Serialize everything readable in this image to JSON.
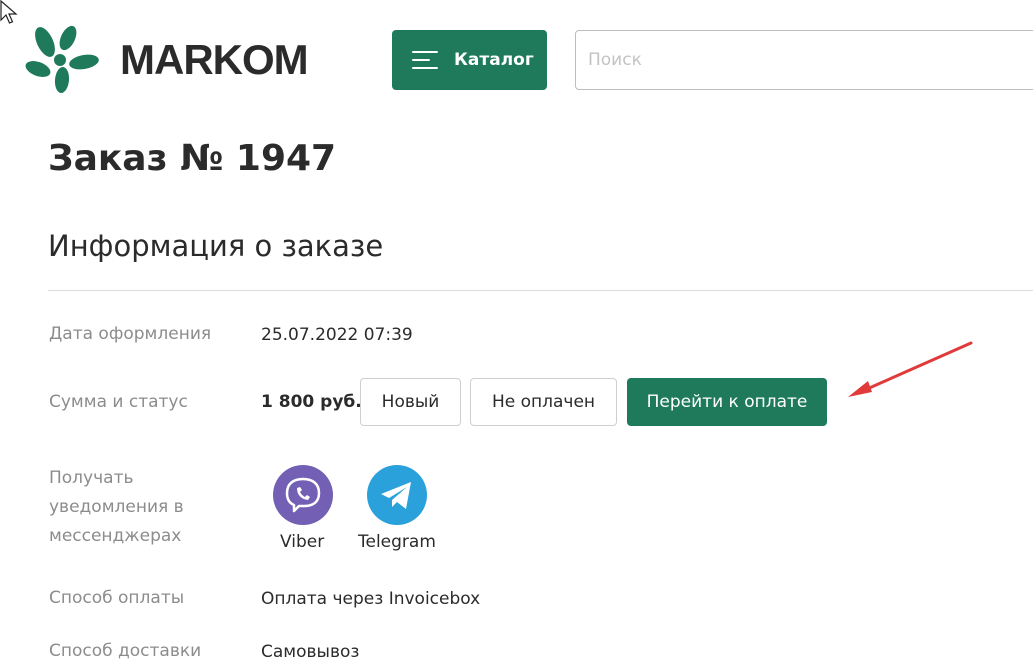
{
  "brand": {
    "name": "MARKOM",
    "accent": "#1f7a5c"
  },
  "header": {
    "catalog_label": "Каталог",
    "search": {
      "placeholder": "Поиск",
      "value": ""
    }
  },
  "order": {
    "title": "Заказ № 1947",
    "section_title": "Информация о заказе",
    "fields": {
      "date": {
        "label": "Дата оформления",
        "value": "25.07.2022 07:39"
      },
      "amount_status": {
        "label": "Сумма и статус",
        "amount": "1 800 руб.",
        "status": "Новый",
        "payment_status": "Не оплачен",
        "pay_button": "Перейти к оплате"
      },
      "notifications": {
        "label_lines": [
          "Получать",
          "уведомления в",
          "мессенджерах"
        ],
        "messengers": [
          {
            "name": "Viber",
            "icon": "viber-icon",
            "color": "#7360b5"
          },
          {
            "name": "Telegram",
            "icon": "telegram-icon",
            "color": "#2aa1da"
          }
        ]
      },
      "payment_method": {
        "label": "Способ оплаты",
        "value": "Оплата через Invoicebox"
      },
      "delivery_method": {
        "label": "Способ доставки",
        "value": "Самовывоз"
      }
    }
  },
  "annotation": {
    "icon": "red-arrow-icon",
    "color": "#e03a3a"
  }
}
